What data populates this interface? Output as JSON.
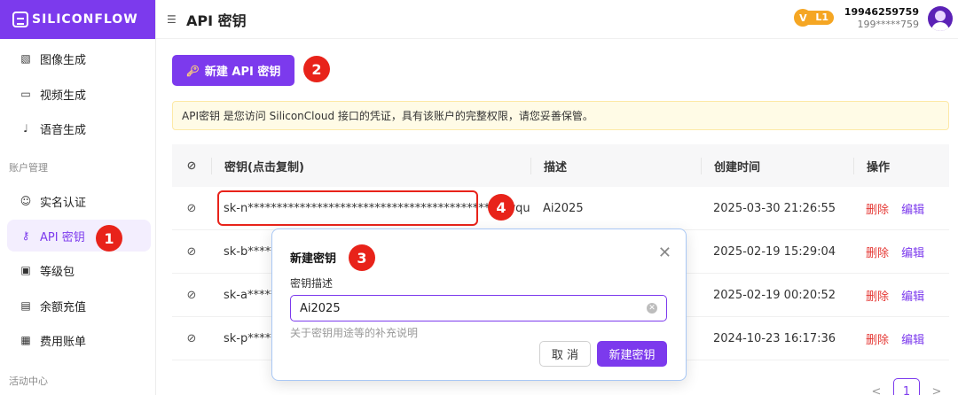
{
  "brand": {
    "logo_text": "SILICONFLOW"
  },
  "sidebar": {
    "items_top": [
      {
        "label": "图像生成",
        "icon": "image-icon"
      },
      {
        "label": "视频生成",
        "icon": "video-icon"
      },
      {
        "label": "语音生成",
        "icon": "microphone-icon"
      }
    ],
    "section_account": "账户管理",
    "items_account": [
      {
        "label": "实名认证",
        "icon": "user-verify-icon"
      },
      {
        "label": "API 密钥",
        "icon": "key-icon"
      },
      {
        "label": "等级包",
        "icon": "package-icon"
      },
      {
        "label": "余额充值",
        "icon": "wallet-icon"
      },
      {
        "label": "费用账单",
        "icon": "bill-icon"
      }
    ],
    "section_activity": "活动中心"
  },
  "header": {
    "title": "API 密钥",
    "vip_letter": "V",
    "level": "L1",
    "phone": "19946259759",
    "phone_masked": "199*****759"
  },
  "toolbar": {
    "create_label": "新建 API 密钥"
  },
  "notice": "API密钥 是您访问 SiliconCloud 接口的凭证，具有该账户的完整权限，请您妥善保管。",
  "table": {
    "headers": {
      "key": "密钥(点击复制)",
      "desc": "描述",
      "created": "创建时间",
      "ops": "操作"
    },
    "rows": [
      {
        "key": "sk-n********************************************hvqu",
        "desc": "Ai2025",
        "created": "2025-03-30 21:26:55"
      },
      {
        "key": "sk-b******",
        "desc": "",
        "created": "2025-02-19 15:29:04"
      },
      {
        "key": "sk-a******",
        "desc": "",
        "created": "2025-02-19 00:20:52"
      },
      {
        "key": "sk-p******",
        "desc": "",
        "created": "2024-10-23 16:17:36"
      }
    ],
    "op_delete": "删除",
    "op_edit": "编辑"
  },
  "modal": {
    "title": "新建密钥",
    "field_label": "密钥描述",
    "field_value": "Ai2025",
    "hint": "关于密钥用途等的补充说明",
    "cancel_label": "取 消",
    "submit_label": "新建密钥"
  },
  "pagination": {
    "prev": "<",
    "current": "1",
    "next": ">"
  },
  "annotations": [
    "1",
    "2",
    "3",
    "4"
  ],
  "colors": {
    "accent": "#7c3aed",
    "danger": "#e53935",
    "annotation": "#e8231a",
    "notice_bg": "#fffbe6"
  }
}
